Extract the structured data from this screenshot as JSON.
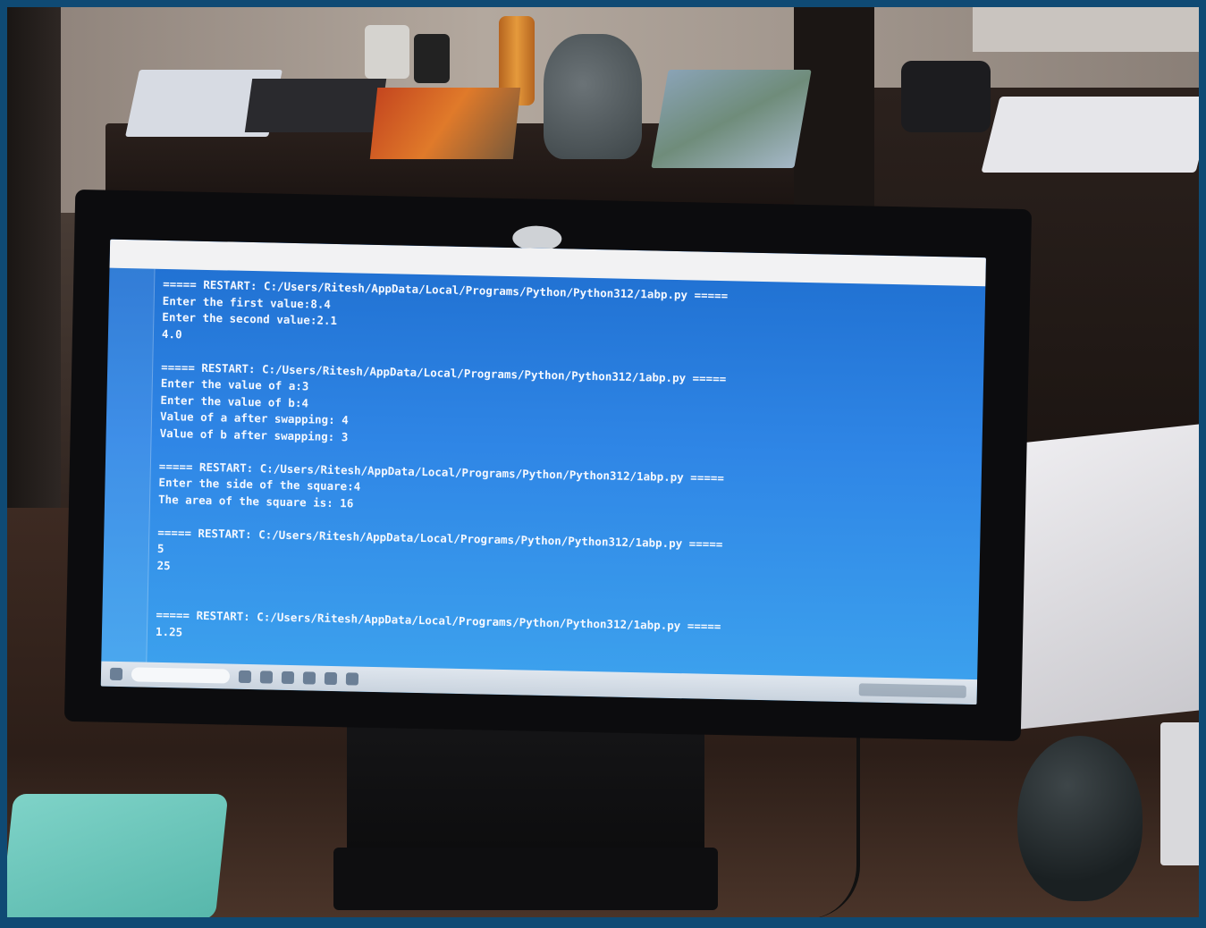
{
  "screen": {
    "window_title": "",
    "console_lines": [
      "===== RESTART: C:/Users/Ritesh/AppData/Local/Programs/Python/Python312/1abp.py =====",
      "Enter the first value:8.4",
      "Enter the second value:2.1",
      "4.0",
      "",
      "===== RESTART: C:/Users/Ritesh/AppData/Local/Programs/Python/Python312/1abp.py =====",
      "Enter the value of a:3",
      "Enter the value of b:4",
      "Value of a after swapping: 4",
      "Value of b after swapping: 3",
      "",
      "===== RESTART: C:/Users/Ritesh/AppData/Local/Programs/Python/Python312/1abp.py =====",
      "Enter the side of the square:4",
      "The area of the square is: 16",
      "",
      "===== RESTART: C:/Users/Ritesh/AppData/Local/Programs/Python/Python312/1abp.py =====",
      "5",
      "25",
      "",
      "",
      "===== RESTART: C:/Users/Ritesh/AppData/Local/Programs/Python/Python312/1abp.py =====",
      "1.25"
    ]
  },
  "icons": {
    "monitor_logo": "hp-logo-icon",
    "taskbar_start": "windows-start-icon",
    "taskbar_search": "search-box",
    "tray": "system-tray-icons"
  },
  "colors": {
    "screen_bg": "#2f86e6",
    "console_text": "#f4f8ff",
    "border": "#0f4a74"
  }
}
